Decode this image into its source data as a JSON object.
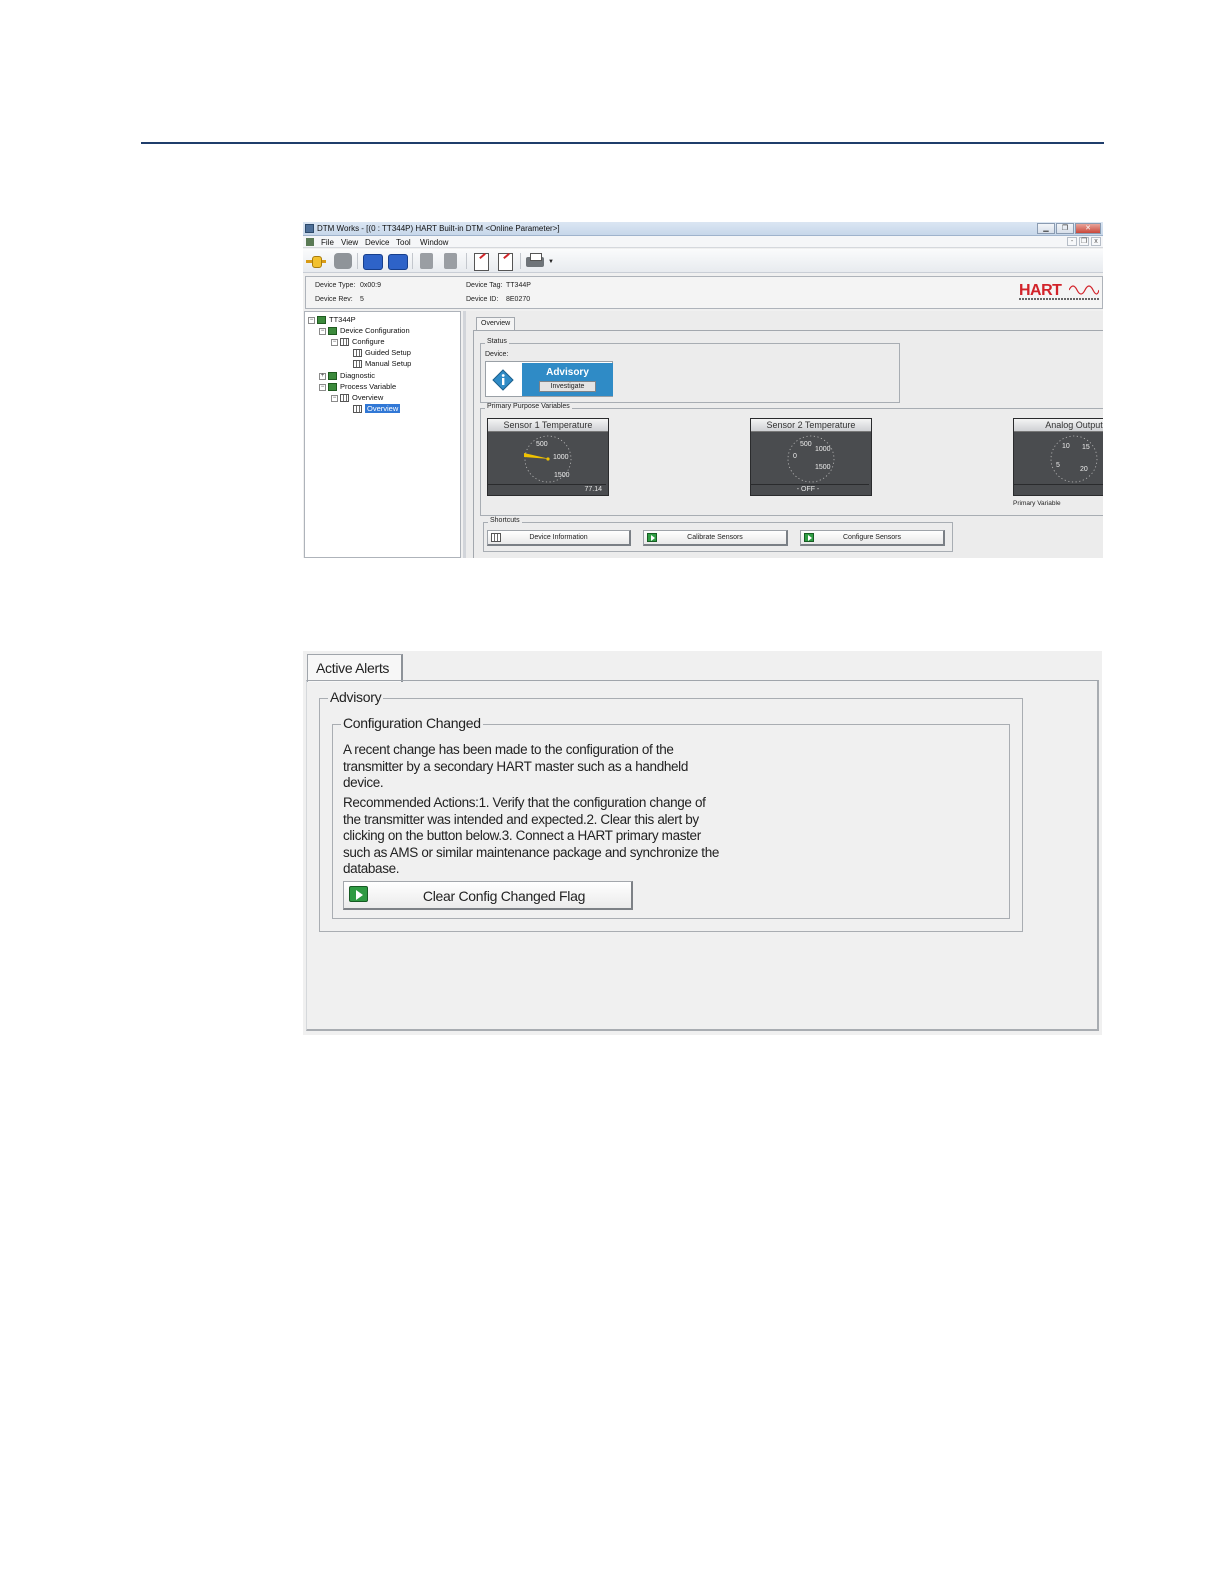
{
  "dtm_window": {
    "title": "DTM Works - [(0 : TT344P) HART Built-in DTM <Online Parameter>]",
    "menu": [
      "File",
      "View",
      "Device",
      "Tool",
      "Window"
    ],
    "toolbar_icons": [
      "connect-icon",
      "disconnect-icon",
      "upload-icon",
      "download-icon",
      "tool-icon",
      "tool-icon",
      "export-icon",
      "import-icon",
      "print-icon"
    ],
    "device_info": {
      "device_type_label": "Device Type:",
      "device_type_value": "0x00:9",
      "device_rev_label": "Device Rev:",
      "device_rev_value": "5",
      "device_tag_label": "Device Tag:",
      "device_tag_value": "TT344P",
      "device_id_label": "Device ID:",
      "device_id_value": "8E0270"
    },
    "logo_text": "HART",
    "tree": [
      {
        "label": "TT344P"
      },
      {
        "label": "Device Configuration"
      },
      {
        "label": "Configure"
      },
      {
        "label": "Guided Setup"
      },
      {
        "label": "Manual Setup"
      },
      {
        "label": "Diagnostic"
      },
      {
        "label": "Process Variable"
      },
      {
        "label": "Overview"
      },
      {
        "label": "Overview"
      }
    ],
    "tab_label": "Overview",
    "status": {
      "group_label": "Status",
      "device_label": "Device:",
      "state": "Advisory",
      "action": "Investigate"
    },
    "primary_vars": {
      "group_label": "Primary Purpose Variables",
      "gauges": [
        {
          "title": "Sensor 1 Temperature",
          "ticks": [
            "500",
            "1000",
            "1500"
          ],
          "value": "77.14"
        },
        {
          "title": "Sensor 2 Temperature",
          "ticks": [
            "500",
            "1000",
            "0",
            "1500"
          ],
          "value": "- OFF -"
        },
        {
          "title": "Analog Output",
          "ticks": [
            "10",
            "15",
            "5",
            "20"
          ],
          "value": ""
        }
      ],
      "primary_variable_label": "Primary Variable"
    },
    "shortcuts": {
      "group_label": "Shortcuts",
      "buttons": [
        "Device Information",
        "Calibrate Sensors",
        "Configure Sensors"
      ]
    }
  },
  "alerts_panel": {
    "tab_label": "Active Alerts",
    "group_label": "Advisory",
    "alert_title": "Configuration Changed",
    "description": "A recent change has been made to the configuration of the transmitter by a secondary HART master such as a handheld device.",
    "recommended_actions": "Recommended Actions:1. Verify that the configuration change of the transmitter was intended and expected.2. Clear this alert by clicking on the button below.3. Connect a HART primary master such as AMS or similar maintenance package and synchronize the database.",
    "button_label": "Clear Config Changed Flag"
  },
  "colors": {
    "rule": "#1f3d6b",
    "advisory_blue": "#2f8bc6",
    "hart_red": "#d2232a",
    "play_green": "#2e9a42"
  }
}
